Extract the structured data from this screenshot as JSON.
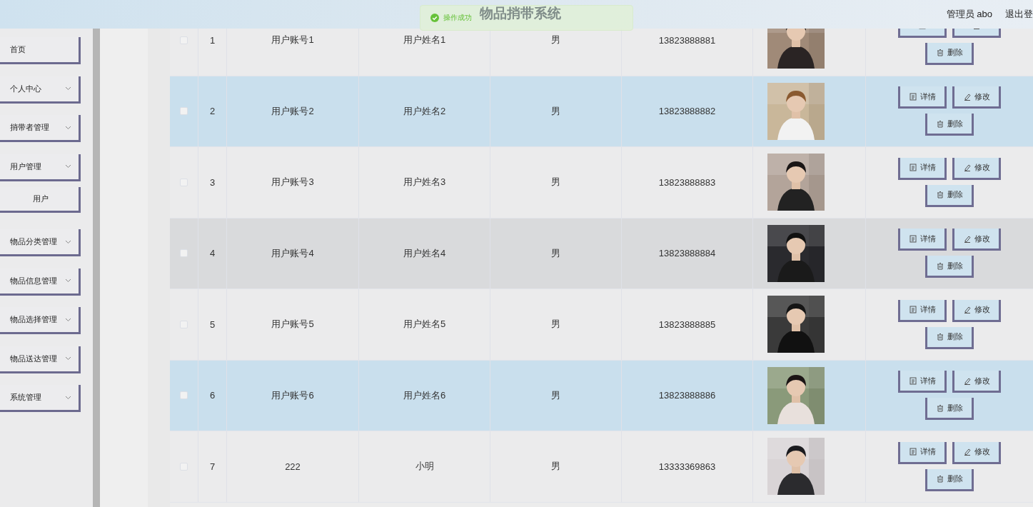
{
  "header": {
    "title": "物品捎带系统",
    "user": "管理员 abo",
    "logout": "退出登"
  },
  "toast": {
    "message": "操作成功"
  },
  "sidebar": {
    "items": [
      {
        "label": "首页",
        "kind": "link"
      },
      {
        "label": "个人中心",
        "kind": "menu"
      },
      {
        "label": "捎带者管理",
        "kind": "menu"
      },
      {
        "label": "用户管理",
        "kind": "menu"
      },
      {
        "label": "用户",
        "kind": "sub"
      },
      {
        "label": "物品分类管理",
        "kind": "menu"
      },
      {
        "label": "物品信息管理",
        "kind": "menu"
      },
      {
        "label": "物品选择管理",
        "kind": "menu"
      },
      {
        "label": "物品送达管理",
        "kind": "menu"
      },
      {
        "label": "系统管理",
        "kind": "menu"
      }
    ]
  },
  "table": {
    "rows": [
      {
        "checked": false,
        "highlighted": false,
        "hovered": false,
        "index": "1",
        "account": "用户账号1",
        "name": "用户姓名1",
        "gender": "男",
        "phone": "13823888881",
        "actions": [
          {
            "kind": "detail"
          },
          {
            "kind": "edit"
          },
          {
            "kind": "delete",
            "label": "删除"
          }
        ]
      },
      {
        "checked": false,
        "highlighted": true,
        "hovered": false,
        "index": "2",
        "account": "用户账号2",
        "name": "用户姓名2",
        "gender": "男",
        "phone": "13823888882",
        "actions": [
          {
            "kind": "detail",
            "label": "详情"
          },
          {
            "kind": "edit",
            "label": "修改"
          },
          {
            "kind": "delete",
            "label": "删除"
          }
        ]
      },
      {
        "checked": false,
        "highlighted": false,
        "hovered": false,
        "index": "3",
        "account": "用户账号3",
        "name": "用户姓名3",
        "gender": "男",
        "phone": "13823888883",
        "actions": [
          {
            "kind": "detail",
            "label": "详情"
          },
          {
            "kind": "edit",
            "label": "修改"
          },
          {
            "kind": "delete",
            "label": "删除"
          }
        ]
      },
      {
        "checked": false,
        "highlighted": false,
        "hovered": true,
        "index": "4",
        "account": "用户账号4",
        "name": "用户姓名4",
        "gender": "男",
        "phone": "13823888884",
        "actions": [
          {
            "kind": "detail",
            "label": "详情"
          },
          {
            "kind": "edit",
            "label": "修改"
          },
          {
            "kind": "delete",
            "label": "删除"
          }
        ]
      },
      {
        "checked": false,
        "highlighted": false,
        "hovered": false,
        "index": "5",
        "account": "用户账号5",
        "name": "用户姓名5",
        "gender": "男",
        "phone": "13823888885",
        "actions": [
          {
            "kind": "detail",
            "label": "详情"
          },
          {
            "kind": "edit",
            "label": "修改"
          },
          {
            "kind": "delete",
            "label": "删除"
          }
        ]
      },
      {
        "checked": false,
        "highlighted": true,
        "hovered": false,
        "index": "6",
        "account": "用户账号6",
        "name": "用户姓名6",
        "gender": "男",
        "phone": "13823888886",
        "actions": [
          {
            "kind": "detail",
            "label": "详情"
          },
          {
            "kind": "edit",
            "label": "修改"
          },
          {
            "kind": "delete",
            "label": "删除"
          }
        ]
      },
      {
        "checked": false,
        "highlighted": false,
        "hovered": false,
        "index": "7",
        "account": "222",
        "name": "小明",
        "gender": "男",
        "phone": "13333369863",
        "actions": [
          {
            "kind": "detail",
            "label": "详情"
          },
          {
            "kind": "edit",
            "label": "修改"
          },
          {
            "kind": "delete",
            "label": "删除"
          }
        ]
      }
    ]
  }
}
